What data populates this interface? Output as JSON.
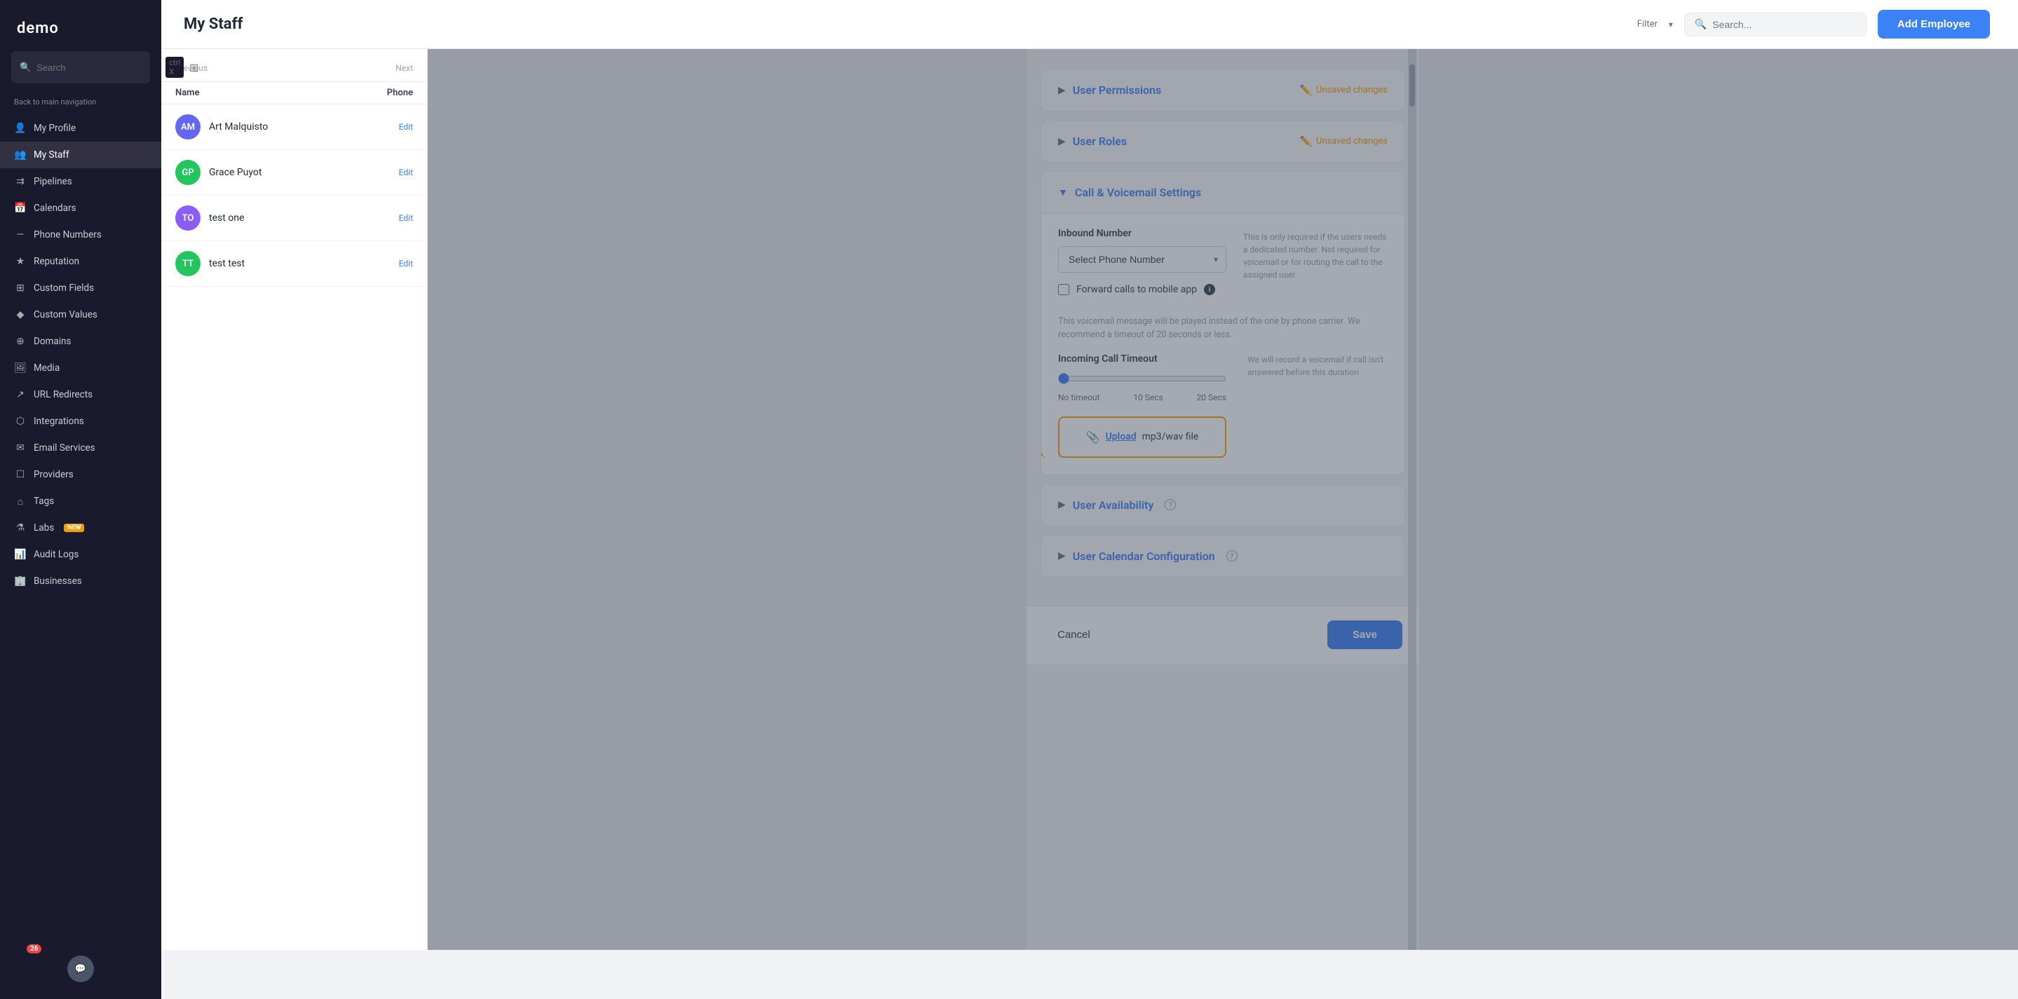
{
  "sidebar": {
    "logo": "demo",
    "search": {
      "placeholder": "Search",
      "shortcut": "ctrl X"
    },
    "back_label": "Back to main navigation",
    "nav_items": [
      {
        "id": "my-profile",
        "label": "My Profile",
        "icon": "person"
      },
      {
        "id": "my-staff",
        "label": "My Staff",
        "icon": "people",
        "active": true
      },
      {
        "id": "pipelines",
        "label": "Pipelines",
        "icon": "pipe"
      },
      {
        "id": "calendars",
        "label": "Calendars",
        "icon": "calendar"
      },
      {
        "id": "phone-numbers",
        "label": "Phone Numbers",
        "icon": "phone"
      },
      {
        "id": "reputation",
        "label": "Reputation",
        "icon": "star"
      },
      {
        "id": "custom-fields",
        "label": "Custom Fields",
        "icon": "grid"
      },
      {
        "id": "custom-values",
        "label": "Custom Values",
        "icon": "diamond"
      },
      {
        "id": "domains",
        "label": "Domains",
        "icon": "globe"
      },
      {
        "id": "media",
        "label": "Media",
        "icon": "image"
      },
      {
        "id": "url-redirects",
        "label": "URL Redirects",
        "icon": "link"
      },
      {
        "id": "integrations",
        "label": "Integrations",
        "icon": "puzzle"
      },
      {
        "id": "email-services",
        "label": "Email Services",
        "icon": "email"
      },
      {
        "id": "providers",
        "label": "Providers",
        "icon": "box"
      },
      {
        "id": "tags",
        "label": "Tags",
        "icon": "tag"
      },
      {
        "id": "labs",
        "label": "Labs",
        "icon": "flask",
        "badge": "NEW"
      },
      {
        "id": "audit-logs",
        "label": "Audit Logs",
        "icon": "chart"
      },
      {
        "id": "businesses",
        "label": "Businesses",
        "icon": "building"
      }
    ],
    "chat_badge": "26"
  },
  "top_bar": {
    "title": "My Staff",
    "search_placeholder": "Search...",
    "add_button": "Add Employee"
  },
  "staff_list": {
    "name_col": "Name",
    "phone_col": "Phone",
    "prev_label": "Previous",
    "next_label": "Next",
    "members": [
      {
        "name": "Art Malquisto",
        "initials": "AM",
        "color": "#6366f1",
        "edit": "Edit"
      },
      {
        "name": "Grace Puyot",
        "initials": "GP",
        "color": "#22c55e",
        "edit": "Edit"
      },
      {
        "name": "test one",
        "initials": "TO",
        "color": "#8b5cf6",
        "edit": "Edit"
      },
      {
        "name": "test test",
        "initials": "TT",
        "color": "#22c55e",
        "edit": "Edit"
      }
    ]
  },
  "form": {
    "sections": [
      {
        "id": "user-permissions",
        "title": "User Permissions",
        "collapsed": true,
        "unsaved": true,
        "unsaved_label": "Unsaved changes"
      },
      {
        "id": "user-roles",
        "title": "User Roles",
        "collapsed": true,
        "unsaved": true,
        "unsaved_label": "Unsaved changes"
      },
      {
        "id": "call-voicemail",
        "title": "Call & Voicemail Settings",
        "collapsed": false,
        "unsaved": false
      }
    ],
    "inbound_number": {
      "label": "Inbound Number",
      "select_placeholder": "Select Phone Number",
      "hint": "This is only required if the users needs a dedicated number. Not required for voicemail or for routing the call to the assigned user."
    },
    "forward_calls": {
      "label": "Forward calls to mobile app",
      "checked": false
    },
    "voicemail_hint": "This voicemail message will be played instead of the one by phone carrier. We recommend a timeout of 20 seconds or less.",
    "timeout": {
      "label": "Incoming Call Timeout",
      "hint": "We will record a voicemail if call isn't answered before this duration",
      "min": 0,
      "max": 2,
      "value": 0,
      "labels": [
        "No timeout",
        "10 Secs",
        "20 Secs"
      ]
    },
    "upload": {
      "link_text": "Upload",
      "text": "mp3/wav file",
      "icon": "paperclip"
    },
    "more_sections": [
      {
        "id": "user-availability",
        "title": "User Availability",
        "has_help": true
      },
      {
        "id": "user-calendar",
        "title": "User Calendar Configuration",
        "has_help": true
      }
    ],
    "footer": {
      "cancel": "Cancel",
      "save": "Save"
    }
  },
  "colors": {
    "accent": "#3b82f6",
    "warning": "#f59e0b",
    "sidebar_bg": "#1a1a2e",
    "overlay": "rgba(55,65,81,0.45)"
  }
}
